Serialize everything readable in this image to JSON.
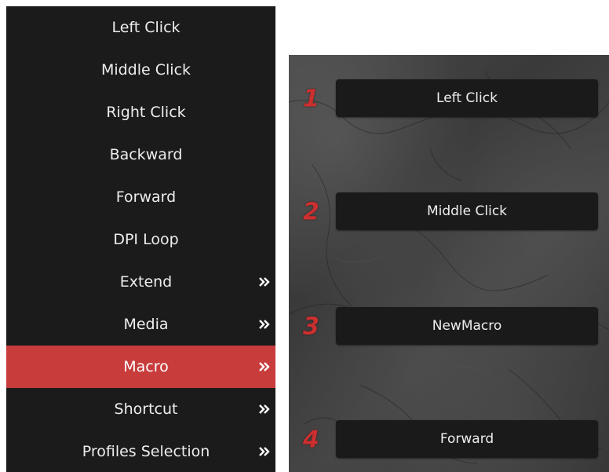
{
  "menu": {
    "items": [
      {
        "label": "Left Click",
        "submenu": false,
        "active": false
      },
      {
        "label": "Middle Click",
        "submenu": false,
        "active": false
      },
      {
        "label": "Right Click",
        "submenu": false,
        "active": false
      },
      {
        "label": "Backward",
        "submenu": false,
        "active": false
      },
      {
        "label": "Forward",
        "submenu": false,
        "active": false
      },
      {
        "label": "DPI Loop",
        "submenu": false,
        "active": false
      },
      {
        "label": "Extend",
        "submenu": true,
        "active": false
      },
      {
        "label": "Media",
        "submenu": true,
        "active": false
      },
      {
        "label": "Macro",
        "submenu": true,
        "active": true
      },
      {
        "label": "Shortcut",
        "submenu": true,
        "active": false
      },
      {
        "label": "Profiles Selection",
        "submenu": true,
        "active": false
      }
    ],
    "submenu_icon": "double-chevron-right-icon"
  },
  "buttons": {
    "slots": [
      {
        "number": "1",
        "label": "Left Click"
      },
      {
        "number": "2",
        "label": "Middle Click"
      },
      {
        "number": "3",
        "label": "NewMacro"
      },
      {
        "number": "4",
        "label": "Forward"
      }
    ]
  },
  "colors": {
    "menu_bg": "#1b1b1b",
    "active_bg": "#c83c3c",
    "slot_number": "#cc2f2f",
    "slot_button_bg": "#1a1a1a"
  }
}
